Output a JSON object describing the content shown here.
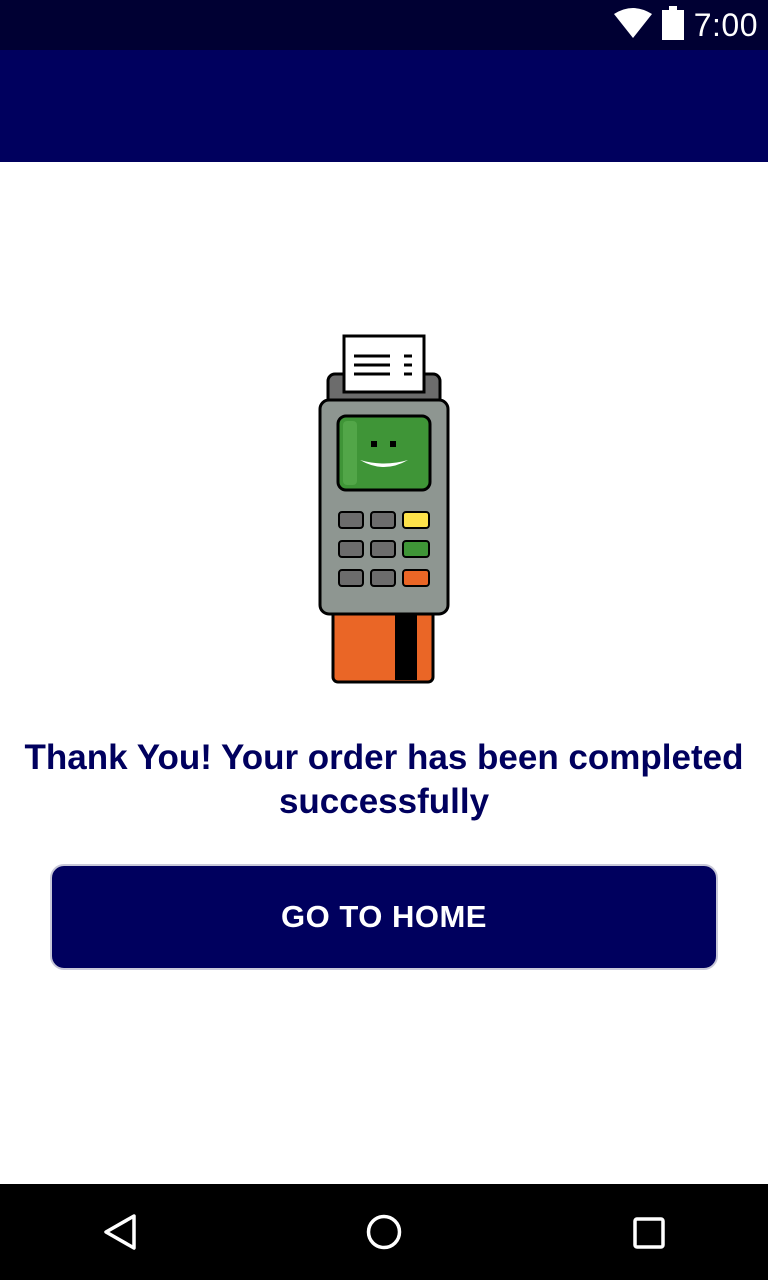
{
  "status_bar": {
    "time": "7:00",
    "icons": [
      "wifi-icon",
      "battery-icon"
    ]
  },
  "main": {
    "illustration": "card-payment-terminal-icon",
    "message": "Thank You! Your order has been completed successfully",
    "home_button_label": "GO TO HOME"
  },
  "nav_bar": {
    "buttons": [
      "back-icon",
      "home-circle-icon",
      "recents-square-icon"
    ]
  },
  "colors": {
    "primary": "#00005e",
    "status_bar": "#000033",
    "terminal_body": "#8e9691",
    "terminal_screen": "#3f9537",
    "card": "#ea6626",
    "key_yellow": "#fde24a",
    "key_green": "#3f9537",
    "key_orange": "#ea6626"
  }
}
